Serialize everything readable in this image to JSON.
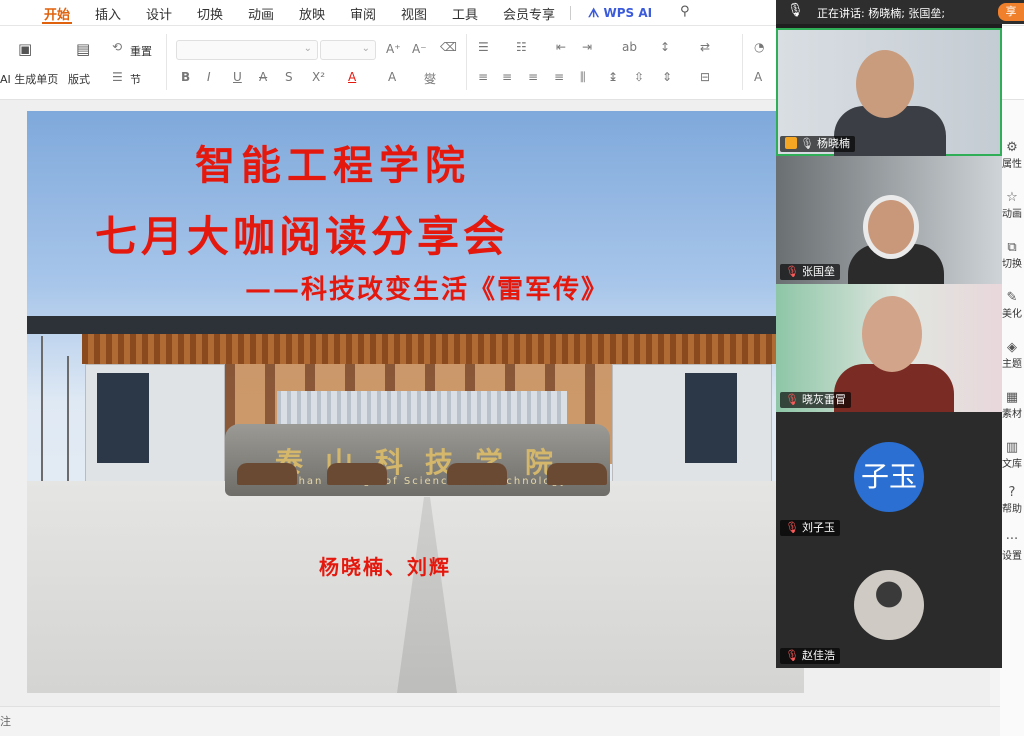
{
  "menu": {
    "items": [
      {
        "label": "开始",
        "active": true
      },
      {
        "label": "插入"
      },
      {
        "label": "设计"
      },
      {
        "label": "切换"
      },
      {
        "label": "动画"
      },
      {
        "label": "放映"
      },
      {
        "label": "审阅"
      },
      {
        "label": "视图"
      },
      {
        "label": "工具"
      },
      {
        "label": "会员专享"
      }
    ],
    "wps_ai": "WPS AI"
  },
  "toolbar": {
    "ai_page": "AI 生成单页",
    "layout": "版式",
    "reset": "重置",
    "section": "节",
    "font_buttons": [
      "B",
      "I",
      "U",
      "A",
      "S",
      "X²",
      "A",
      "A"
    ],
    "grow_font": "A⁺",
    "shrink_font": "A⁻"
  },
  "slide": {
    "title1": "智能工程学院",
    "title2": "七月大咖阅读分享会",
    "subtitle": "——科技改变生活《雷军传》",
    "authors": "杨晓楠、刘辉",
    "stone_cn": "泰山科技学院",
    "stone_en": "Taishan College of Science and Technology"
  },
  "side_panel": {
    "items": [
      "属性",
      "动画",
      "切换",
      "美化",
      "主题",
      "素材",
      "文库",
      "帮助",
      "设置"
    ]
  },
  "meeting": {
    "speaking_text": "正在讲话: 杨晓楠; 张国垒;",
    "share_label": "享",
    "participants": [
      {
        "name": "杨晓楠",
        "host": true,
        "active": true
      },
      {
        "name": "张国垒"
      },
      {
        "name": "晓灰雷冒"
      },
      {
        "name": "刘子玉",
        "avatar_text": "子玉"
      },
      {
        "name": "赵佳浩"
      }
    ]
  },
  "status": {
    "left_text": "注"
  },
  "colors": {
    "accent": "#e0620d",
    "title_red": "#e5180e",
    "active_speaker": "#2fae57",
    "avatar_blue": "#2a6fd1"
  }
}
